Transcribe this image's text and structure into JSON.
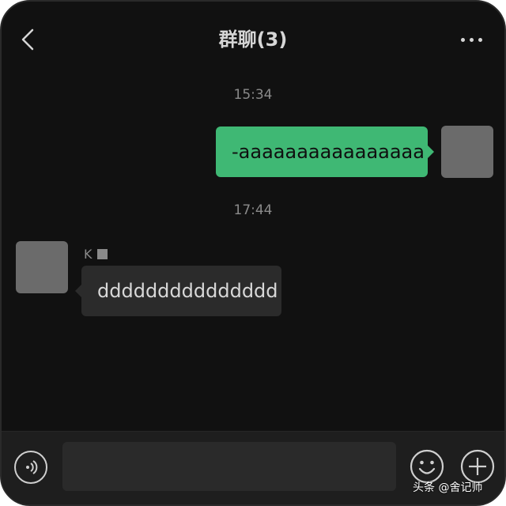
{
  "header": {
    "title": "群聊(3)",
    "back_icon": "chevron-left-icon",
    "more_icon": "more-dots-icon"
  },
  "messages": [
    {
      "time": "15:34",
      "direction": "outgoing",
      "text": "-aaaaaaaaaaaaaaaa"
    },
    {
      "time": "17:44",
      "direction": "incoming",
      "sender": "K",
      "text": "ddddddddddddddd"
    }
  ],
  "input_bar": {
    "placeholder": "",
    "value": "",
    "voice_icon": "voice-icon",
    "emoji_icon": "emoji-icon",
    "plus_icon": "plus-icon"
  },
  "watermark": "头条 @舍记师",
  "colors": {
    "background": "#111111",
    "outgoing_bubble": "#3fb874",
    "incoming_bubble": "#2b2b2b",
    "avatar": "#6b6b6b"
  }
}
